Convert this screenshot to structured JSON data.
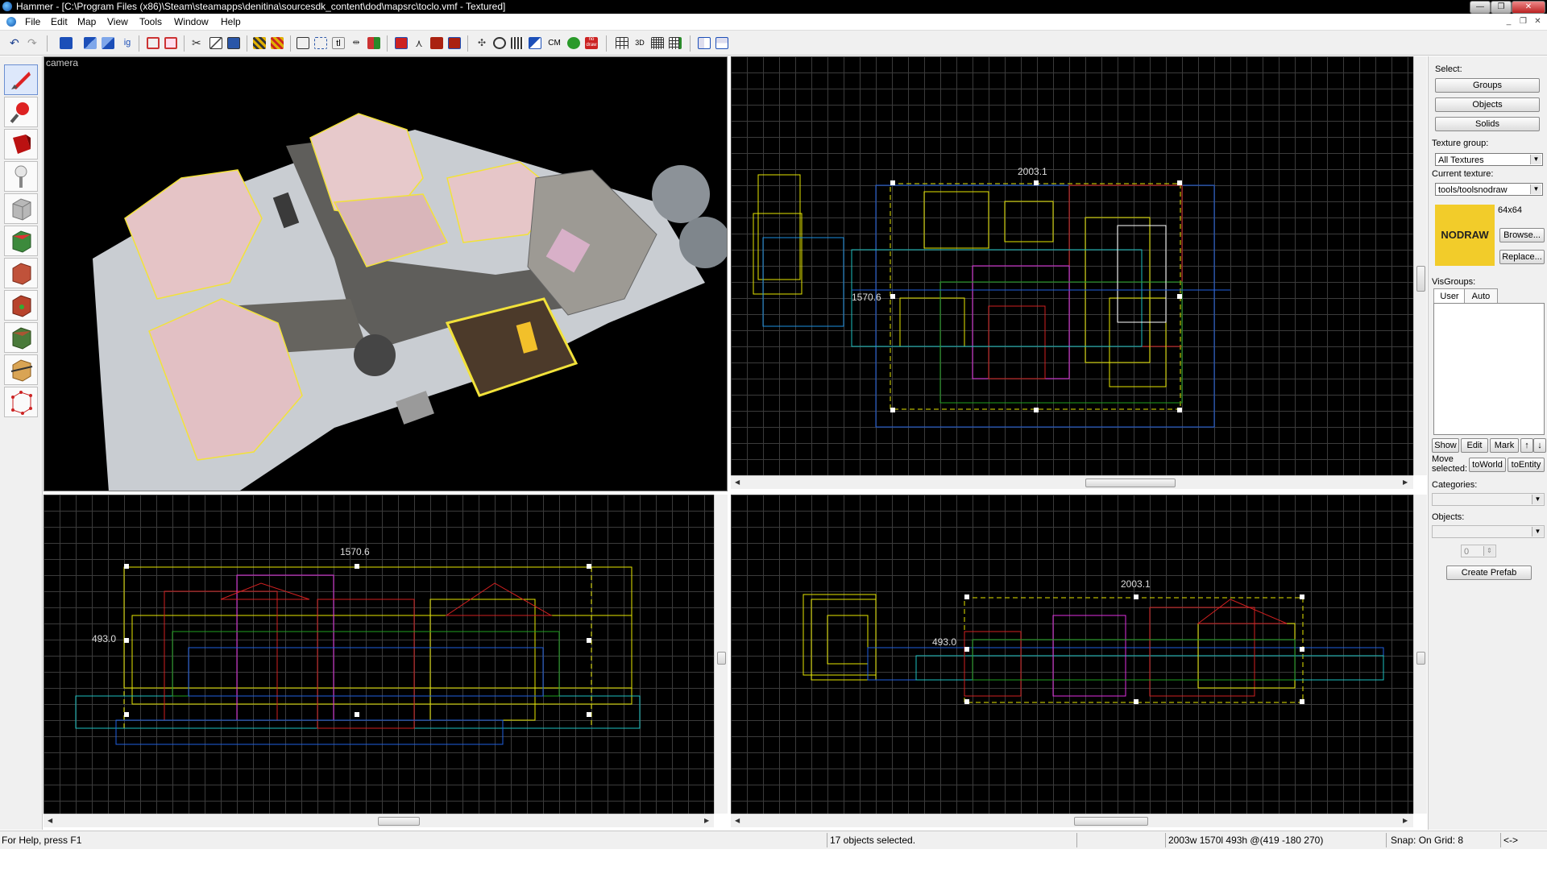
{
  "window": {
    "title": "Hammer - [C:\\Program Files (x86)\\Steam\\steamapps\\denitina\\sourcesdk_content\\dod\\mapsrc\\toclo.vmf - Textured]",
    "controls": [
      "minimize",
      "restore",
      "close"
    ]
  },
  "menu": {
    "items": [
      "File",
      "Edit",
      "Map",
      "View",
      "Tools",
      "Window",
      "Help"
    ]
  },
  "toolbar": {
    "icons": [
      "undo-icon",
      "redo-icon",
      "carve-icon",
      "group-icon",
      "ungroup-icon",
      "ignore-group-icon",
      "hide-icon",
      "show-icon",
      "cut-icon",
      "copy-icon",
      "paste-icon",
      "texture-lock-icon",
      "texture-scale-lock-icon",
      "selection-box-icon",
      "select-tool-icon",
      "tie-entity-icon",
      "move-to-world-icon",
      "flip-icon",
      "compile-icon",
      "vertex-icon",
      "clip-icon",
      "decal-icon",
      "toggle-3d-icon",
      "toggle-helpers-icon",
      "models-icon",
      "cordon-icon",
      "cm-icon",
      "nodraw-icon",
      "grid-icon",
      "3d-grid-icon",
      "grid-smaller-icon",
      "grid-larger-icon",
      "tile-icon",
      "cascade-icon"
    ],
    "cm_label": "CM",
    "nodraw_label": "no draw"
  },
  "tools": {
    "items": [
      "selection-tool",
      "magnify-tool",
      "camera-tool",
      "entity-tool",
      "block-tool",
      "texture-application-tool",
      "apply-current-texture-tool",
      "apply-decals-tool",
      "apply-overlays-tool",
      "clipping-tool",
      "vertex-tool"
    ]
  },
  "viewports": {
    "camera": {
      "label": "camera"
    },
    "top": {
      "width_label": "2003.1",
      "height_label": "1570.6"
    },
    "front": {
      "width_label": "1570.6",
      "height_label": "493.0"
    },
    "side": {
      "width_label": "2003.1",
      "height_label": "493.0"
    }
  },
  "panel": {
    "select_label": "Select:",
    "groups_button": "Groups",
    "objects_button": "Objects",
    "solids_button": "Solids",
    "texture_group_label": "Texture group:",
    "texture_group_value": "All Textures",
    "current_texture_label": "Current texture:",
    "current_texture_value": "tools/toolsnodraw",
    "texture_size": "64x64",
    "texture_preview_text": "NODRAW",
    "texture_preview_color": "#f2cc2a",
    "browse_button": "Browse...",
    "replace_button": "Replace...",
    "visgroups_label": "VisGroups:",
    "tab_user": "User",
    "tab_auto": "Auto",
    "show_button": "Show",
    "edit_button": "Edit",
    "mark_button": "Mark",
    "up_icon": "up-arrow-icon",
    "down_icon": "down-arrow-icon",
    "move_selected_label": "Move selected:",
    "to_world_button": "toWorld",
    "to_entity_button": "toEntity",
    "categories_label": "Categories:",
    "categories_value": "",
    "objects_label": "Objects:",
    "objects_value": "",
    "prefab_count": "0",
    "create_prefab_button": "Create Prefab"
  },
  "status": {
    "help": "For Help, press F1",
    "selection": "17 objects selected.",
    "dimensions": "2003w 1570l 493h @(419 -180 270)",
    "snap": "Snap: On Grid: 8",
    "arrows": "<->"
  }
}
